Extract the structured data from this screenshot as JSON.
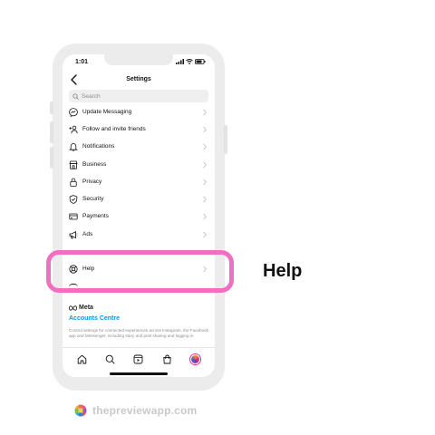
{
  "status_bar": {
    "time": "1:01"
  },
  "nav": {
    "title": "Settings"
  },
  "search": {
    "placeholder": "Search"
  },
  "menu": [
    {
      "label": "Update Messaging",
      "icon": "messenger-icon"
    },
    {
      "label": "Follow and invite friends",
      "icon": "add-person-icon"
    },
    {
      "label": "Notifications",
      "icon": "bell-icon"
    },
    {
      "label": "Business",
      "icon": "store-icon"
    },
    {
      "label": "Privacy",
      "icon": "lock-icon"
    },
    {
      "label": "Security",
      "icon": "shield-icon"
    },
    {
      "label": "Payments",
      "icon": "card-icon"
    },
    {
      "label": "Ads",
      "icon": "megaphone-icon"
    },
    {
      "label": "Help",
      "icon": "lifebuoy-icon"
    }
  ],
  "meta": {
    "brand": "Meta",
    "accounts_link": "Accounts Centre",
    "description": "Control settings for connected experiences across Instagram, the Facebook app and Messenger, including story and post sharing and logging in."
  },
  "callout": {
    "label": "Help"
  },
  "footer": {
    "brand": "thepreviewapp.com"
  },
  "colors": {
    "highlight": "#f06fc3",
    "link": "#0095f6",
    "frame": "#ececec"
  }
}
